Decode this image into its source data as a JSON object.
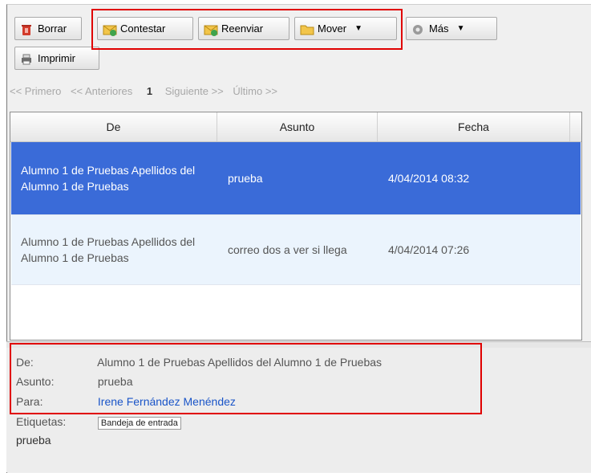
{
  "toolbar": {
    "borrar": "Borrar",
    "contestar": "Contestar",
    "reenviar": "Reenviar",
    "mover": "Mover",
    "mas": "Más",
    "imprimir": "Imprimir"
  },
  "pager": {
    "first": "<< Primero",
    "prev": "<< Anteriores",
    "current": "1",
    "next": "Siguiente >>",
    "last": "Último >>"
  },
  "table": {
    "columns": [
      "De",
      "Asunto",
      "Fecha"
    ],
    "rows": [
      {
        "de": "Alumno 1 de Pruebas Apellidos del Alumno 1 de Pruebas",
        "asunto": "prueba",
        "fecha": "4/04/2014 08:32",
        "selected": true
      },
      {
        "de": "Alumno 1 de Pruebas Apellidos del Alumno 1 de Pruebas",
        "asunto": "correo dos a ver si llega",
        "fecha": "4/04/2014 07:26",
        "selected": false
      }
    ]
  },
  "preview": {
    "de_label": "De:",
    "de_value": "Alumno 1 de Pruebas Apellidos del Alumno 1 de Pruebas",
    "asunto_label": "Asunto:",
    "asunto_value": "prueba",
    "para_label": "Para:",
    "para_value": "Irene Fernández Menéndez",
    "etiquetas_label": "Etiquetas:",
    "etiquetas_value": "Bandeja de entrada",
    "body": "prueba"
  },
  "colors": {
    "selected_row": "#3a6bd8",
    "alt_row": "#ebf4fd",
    "highlight": "#e00000",
    "link": "#1a55c8"
  }
}
